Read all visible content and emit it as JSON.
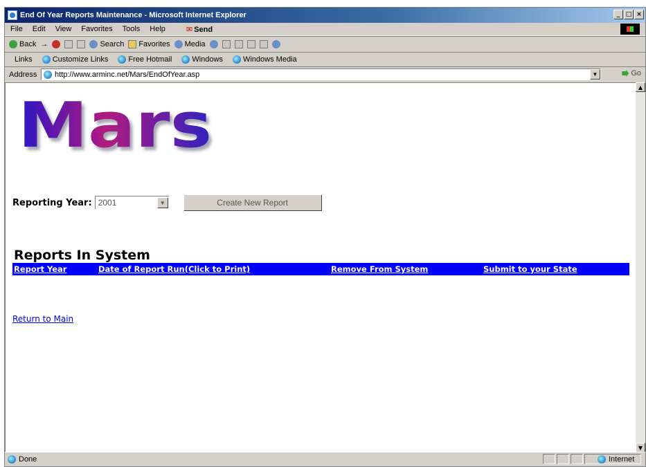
{
  "window": {
    "title": "End Of Year Reports Maintenance - Microsoft Internet Explorer",
    "controls": [
      "_",
      "□",
      "×"
    ]
  },
  "menubar": {
    "items": [
      "File",
      "Edit",
      "View",
      "Favorites",
      "Tools",
      "Help"
    ],
    "send": "Send"
  },
  "toolbar": {
    "back": "Back",
    "forward": "→",
    "search": "Search",
    "favorites": "Favorites",
    "media": "Media"
  },
  "linksbar": {
    "label": "Links",
    "links": [
      "Customize Links",
      "Free Hotmail",
      "Windows",
      "Windows Media"
    ]
  },
  "addressbar": {
    "label": "Address",
    "url": "http://www.arminc.net/Mars/EndOfYear.asp",
    "go": "Go"
  },
  "page": {
    "logo_text": "Mars",
    "reporting_year_label": "Reporting Year:",
    "reporting_year_value": "2001",
    "create_button": "Create New Report",
    "reports_heading": "Reports In System",
    "table_headers": [
      "Report Year",
      "Date of Report Run(Click to Print)",
      "Remove From System",
      "Submit to your State"
    ],
    "return_link": "Return to Main"
  },
  "statusbar": {
    "status": "Done",
    "zone": "Internet"
  }
}
